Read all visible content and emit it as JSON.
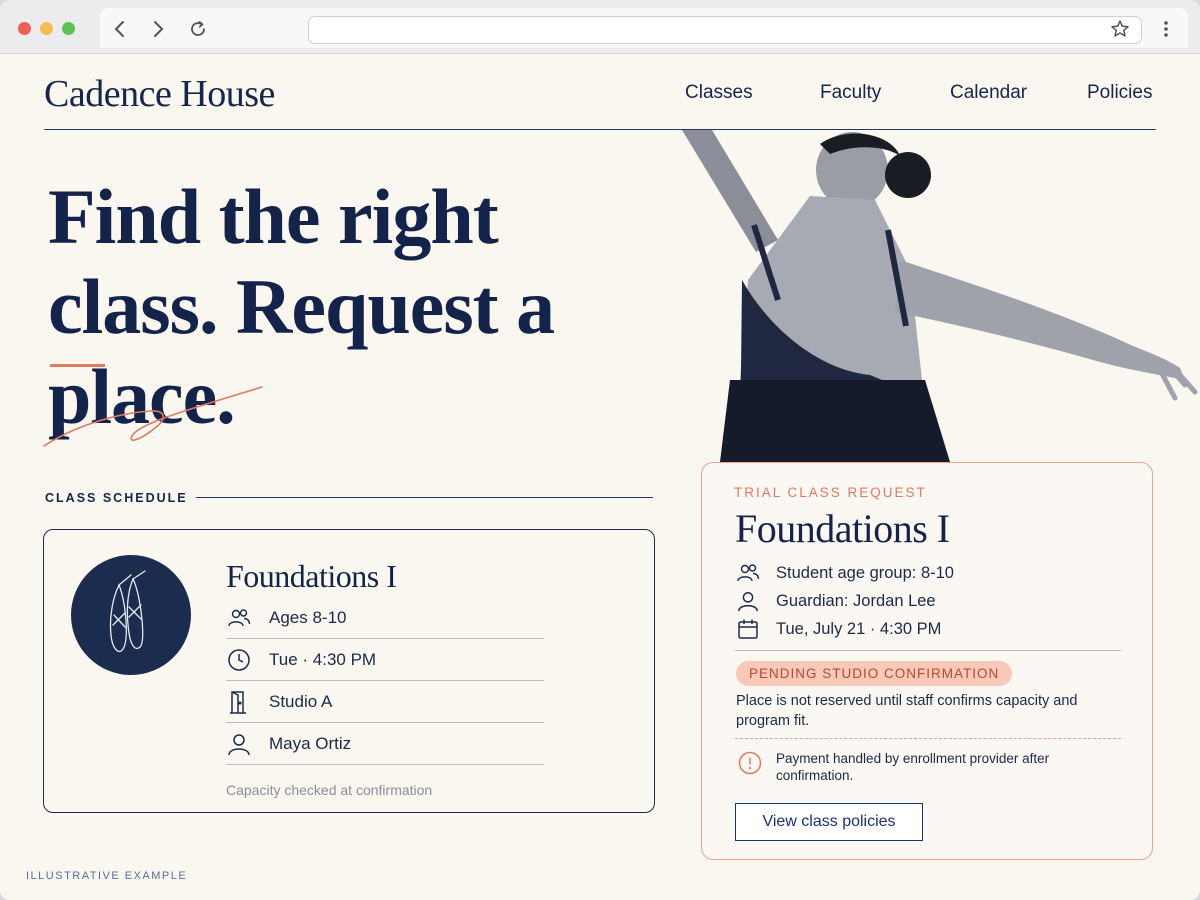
{
  "browser": {
    "url": ""
  },
  "site": {
    "brand": "Cadence House",
    "nav": [
      "Classes",
      "Faculty",
      "Calendar",
      "Policies"
    ]
  },
  "hero": {
    "title_line1": "Find the right",
    "title_line2": "class.  Request a place."
  },
  "schedule": {
    "label": "CLASS SCHEDULE",
    "class_title": "Foundations I",
    "details": [
      {
        "icon": "people-icon",
        "text": "Ages 8-10"
      },
      {
        "icon": "clock-icon",
        "text": "Tue  ·  4:30 PM"
      },
      {
        "icon": "door-icon",
        "text": "Studio A"
      },
      {
        "icon": "person-icon",
        "text": "Maya Ortiz"
      }
    ],
    "capacity_note": "Capacity checked at confirmation"
  },
  "request": {
    "eyebrow": "TRIAL CLASS REQUEST",
    "title": "Foundations I",
    "rows": [
      {
        "icon": "people-icon",
        "text": "Student age group: 8-10"
      },
      {
        "icon": "person-icon",
        "text": "Guardian: Jordan Lee"
      },
      {
        "icon": "calendar-icon",
        "text": "Tue, July 21  ·  4:30 PM"
      }
    ],
    "status": "PENDING STUDIO CONFIRMATION",
    "note": "Place is not reserved until staff confirms capacity and program fit.",
    "payment_note": "Payment handled by enrollment provider after confirmation.",
    "button": "View class policies"
  },
  "footer_note": "ILLUSTRATIVE EXAMPLE",
  "colors": {
    "navy": "#13234a",
    "accent": "#e07a5f",
    "cream": "#faf6f0",
    "pending_bg": "#f8c8b8"
  }
}
